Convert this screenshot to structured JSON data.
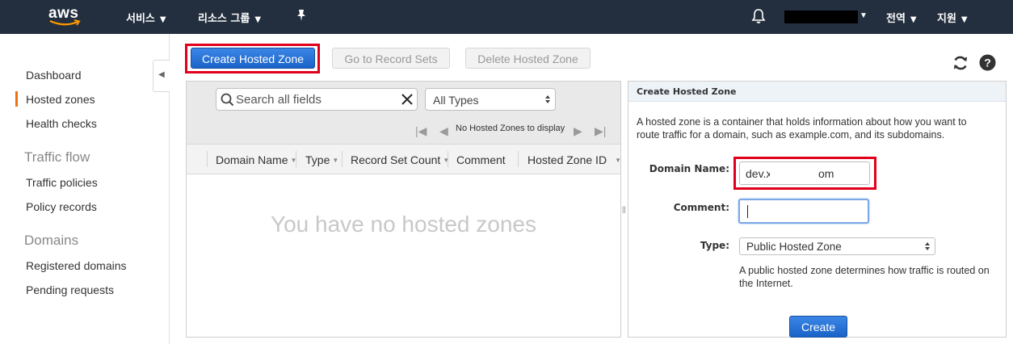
{
  "topnav": {
    "logo_text": "aws",
    "services": "서비스",
    "resource_groups": "리소스 그룹",
    "region": "전역",
    "support": "지원"
  },
  "sidebar": {
    "items": [
      {
        "label": "Dashboard"
      },
      {
        "label": "Hosted zones",
        "active": true
      },
      {
        "label": "Health checks"
      }
    ],
    "traffic_flow": {
      "heading": "Traffic flow",
      "items": [
        {
          "label": "Traffic policies"
        },
        {
          "label": "Policy records"
        }
      ]
    },
    "domains": {
      "heading": "Domains",
      "items": [
        {
          "label": "Registered domains"
        },
        {
          "label": "Pending requests"
        }
      ]
    }
  },
  "toolbar": {
    "create_label": "Create Hosted Zone",
    "goto_label": "Go to Record Sets",
    "delete_label": "Delete Hosted Zone"
  },
  "list": {
    "search_placeholder": "Search all fields",
    "type_filter": "All Types",
    "pager_text": "No Hosted Zones to display",
    "columns": [
      "Domain Name",
      "Type",
      "Record Set Count",
      "Comment",
      "Hosted Zone ID"
    ],
    "empty_message": "You have no hosted zones"
  },
  "create_panel": {
    "title": "Create Hosted Zone",
    "description": "A hosted zone is a container that holds information about how you want to route traffic for a domain, such as example.com, and its subdomains.",
    "domain_label": "Domain Name:",
    "domain_value": "dev.x          n.com",
    "comment_label": "Comment:",
    "comment_value": "",
    "type_label": "Type:",
    "type_value": "Public Hosted Zone",
    "type_help": "A public hosted zone determines how traffic is routed on the Internet.",
    "create_button": "Create"
  },
  "colors": {
    "nav_bg": "#232f3e",
    "primary": "#1f6fd8",
    "active_accent": "#ec7211",
    "highlight": "#e0001b"
  }
}
